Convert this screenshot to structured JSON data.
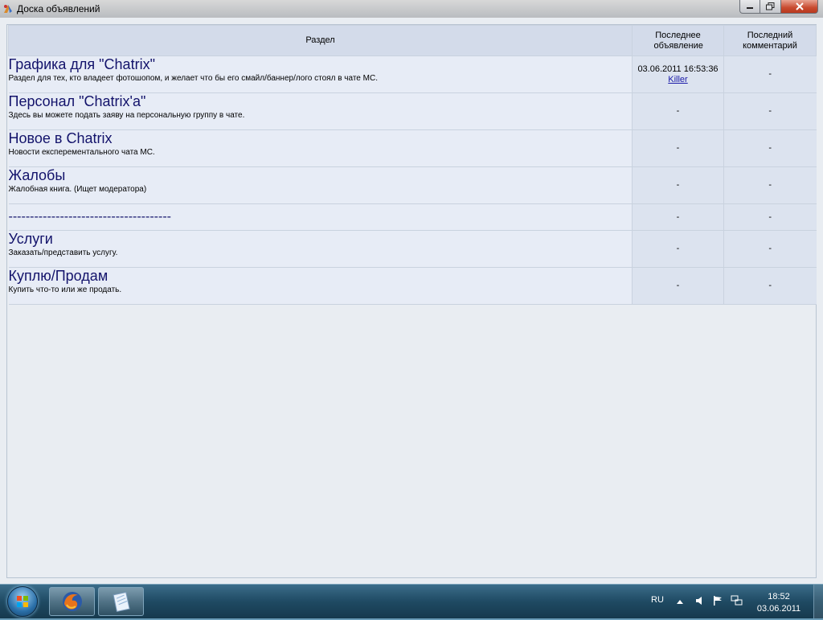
{
  "window": {
    "title": "Доска объявлений",
    "icons": {
      "app": "app-icon",
      "minimize": "minimize-icon",
      "maximize": "maximize-icon",
      "close": "close-icon"
    }
  },
  "table": {
    "headers": {
      "section": "Раздел",
      "last_post": "Последнее объявление",
      "last_comment": "Последний комментарий"
    },
    "rows": [
      {
        "title": "Графика для \"Chatrix\"",
        "desc": "Раздел для тех, кто владеет фотошопом, и желает что бы его смайл/баннер/лого стоял в чате МС.",
        "last_date": "03.06.2011 16:53:36",
        "last_author": "Killer",
        "last_comment": "-"
      },
      {
        "title": "Персонал \"Chatrix'а\"",
        "desc": "Здесь вы можете подать заяву на персональную группу в чате.",
        "last_date": "-",
        "last_author": "",
        "last_comment": "-"
      },
      {
        "title": "Новое в Chatrix",
        "desc": "Новости експерементального чата МС.",
        "last_date": "-",
        "last_author": "",
        "last_comment": "-"
      },
      {
        "title": "Жалобы",
        "desc": "Жалобная книга. (Ищет модератора)",
        "last_date": "-",
        "last_author": "",
        "last_comment": "-"
      },
      {
        "title": "--------------------------------------",
        "desc": "",
        "last_date": "-",
        "last_author": "",
        "last_comment": "-"
      },
      {
        "title": "Услуги",
        "desc": "Заказать/представить услугу.",
        "last_date": "-",
        "last_author": "",
        "last_comment": "-"
      },
      {
        "title": "Куплю/Продам",
        "desc": "Купить что-то или же продать.",
        "last_date": "-",
        "last_author": "",
        "last_comment": "-"
      }
    ]
  },
  "taskbar": {
    "start_icon": "windows-orb-icon",
    "apps": [
      "firefox-icon",
      "notepad-icon"
    ],
    "lang": "RU",
    "tray_icons": [
      "show-hidden-icons-arrow",
      "speaker-icon",
      "action-center-flag-icon",
      "network-icon"
    ],
    "time": "18:52",
    "date": "03.06.2011"
  }
}
